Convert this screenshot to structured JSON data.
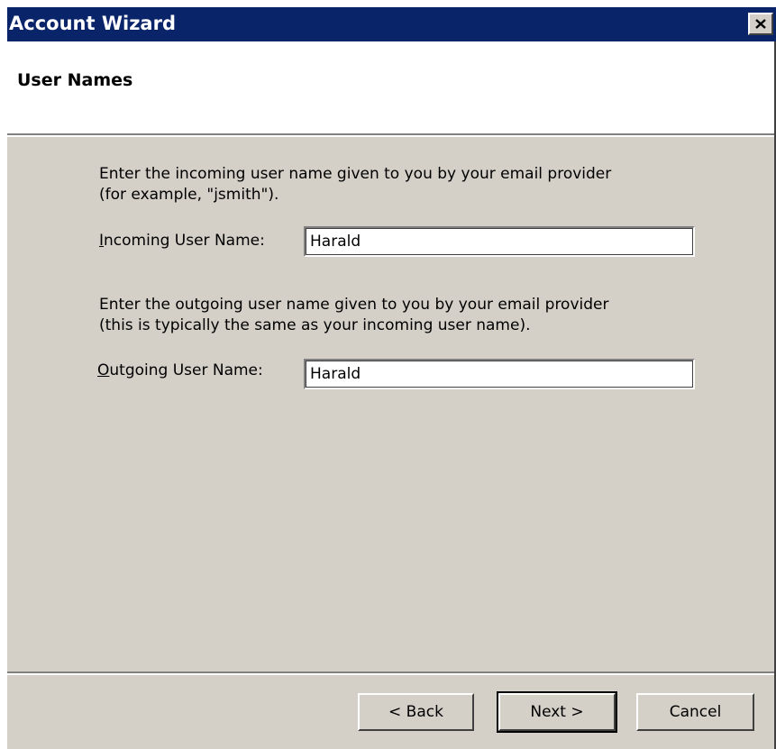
{
  "window": {
    "title": "Account Wizard",
    "title_bar_color": "#0a246a",
    "close_icon": "close-icon"
  },
  "header": {
    "title": "User Names"
  },
  "incoming": {
    "description": "Enter the incoming user name given to you by your email provider\n(for example, \"jsmith\").",
    "label_accel": "I",
    "label_rest": "ncoming User Name:",
    "value": "Harald"
  },
  "outgoing": {
    "description": "Enter the outgoing user name given to you by your email provider\n(this is typically the same as your incoming user name).",
    "label_accel": "O",
    "label_rest": "utgoing User Name:",
    "value": "Harald"
  },
  "buttons": {
    "back": "< Back",
    "next": "Next >",
    "cancel": "Cancel"
  }
}
